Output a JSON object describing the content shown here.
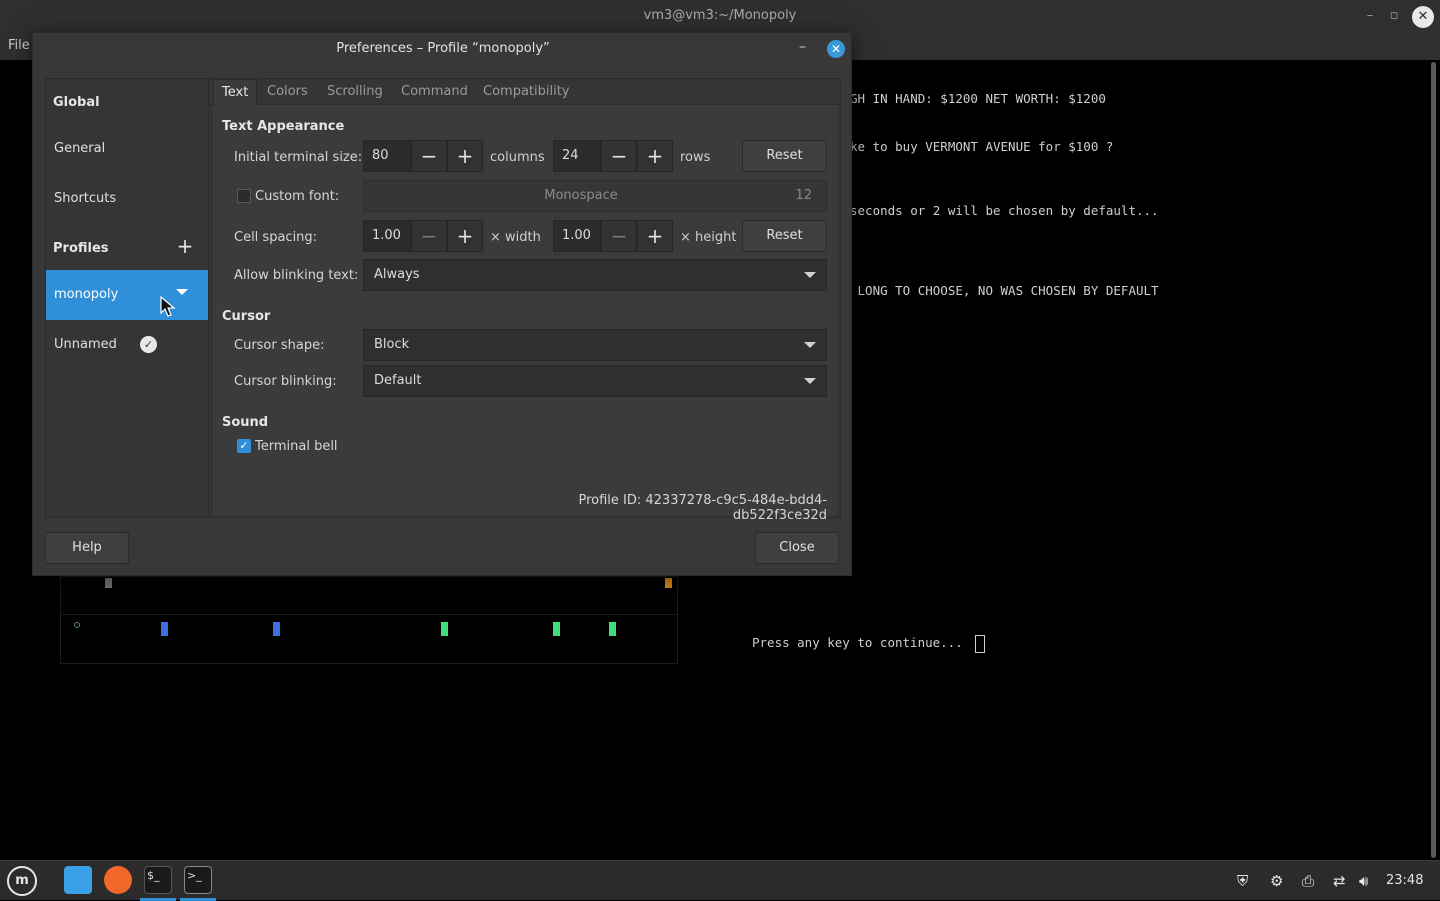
{
  "terminal": {
    "title": "vm3@vm3:~/Monopoly",
    "menu_file": "File",
    "lines": [
      "GH IN HAND: $1200 NET WORTH: $1200",
      "ke to buy VERMONT AVENUE for $100 ?",
      "seconds or 2 will be chosen by default...",
      " LONG TO CHOOSE, NO WAS CHOSEN BY DEFAULT",
      "Press any key to continue..."
    ]
  },
  "dialog": {
    "title": "Preferences – Profile “monopoly”",
    "sidebar": {
      "global_heading": "Global",
      "general": "General",
      "shortcuts": "Shortcuts",
      "profiles_heading": "Profiles",
      "profiles": [
        "monopoly",
        "Unnamed"
      ]
    },
    "tabs": [
      "Text",
      "Colors",
      "Scrolling",
      "Command",
      "Compatibility"
    ],
    "text_appearance": {
      "heading": "Text Appearance",
      "initial_size_label": "Initial terminal size:",
      "columns_value": "80",
      "columns_unit": "columns",
      "rows_value": "24",
      "rows_unit": "rows",
      "reset_label": "Reset",
      "custom_font_label": "Custom font:",
      "font_name": "Monospace",
      "font_size": "12",
      "cell_spacing_label": "Cell spacing:",
      "width_value": "1.00",
      "width_unit": "× width",
      "height_value": "1.00",
      "height_unit": "× height",
      "blink_label": "Allow blinking text:",
      "blink_value": "Always"
    },
    "cursor": {
      "heading": "Cursor",
      "shape_label": "Cursor shape:",
      "shape_value": "Block",
      "blinking_label": "Cursor blinking:",
      "blinking_value": "Default"
    },
    "sound": {
      "heading": "Sound",
      "bell_label": "Terminal bell",
      "bell_checked": true
    },
    "profile_id": "Profile ID:  42337278-c9c5-484e-bdd4-db522f3ce32d",
    "help_label": "Help",
    "close_label": "Close"
  },
  "taskbar": {
    "clock": "23:48",
    "icons": [
      "menu-icon",
      "files-icon",
      "firefox-icon",
      "terminal-icon",
      "terminal-active-icon"
    ]
  },
  "colors": {
    "accent": "#2f8fd8",
    "dialog_bg": "#383838",
    "marker_blue": "#3b6fe0",
    "marker_green": "#3fe07a",
    "marker_orange": "#e0901a"
  }
}
